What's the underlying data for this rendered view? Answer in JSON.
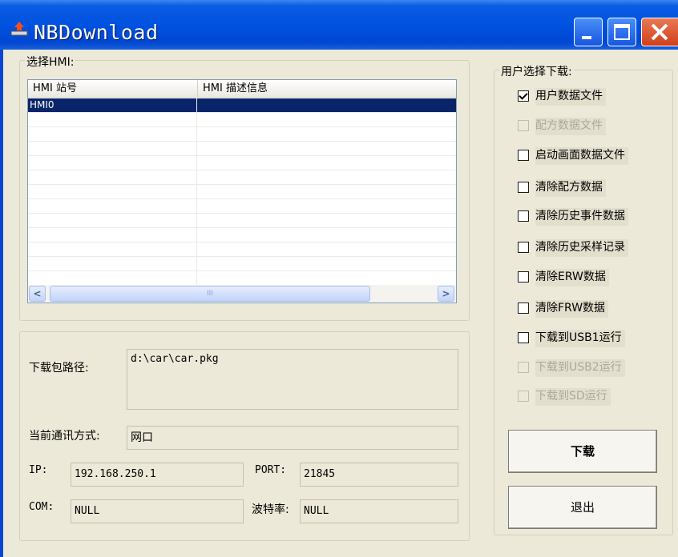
{
  "window": {
    "title": "NBDownload"
  },
  "hmi_group": {
    "title": "选择HMI:",
    "columns": [
      "HMI 站号",
      "HMI 描述信息"
    ],
    "rows": [
      {
        "station": "HMI0",
        "description": ""
      }
    ],
    "scroll_left": "<",
    "scroll_right": ">",
    "scroll_grip": "III"
  },
  "info": {
    "path_label": "下载包路径:",
    "path_value": "d:\\car\\car.pkg",
    "comm_label": "当前通讯方式:",
    "comm_value": "网口",
    "ip_label": "IP:",
    "ip_value": "192.168.250.1",
    "port_label": "PORT:",
    "port_value": "21845",
    "com_label": "COM:",
    "com_value": "NULL",
    "baud_label": "波特率:",
    "baud_value": "NULL"
  },
  "options": {
    "title": "用户选择下载:",
    "items": [
      {
        "label": "用户数据文件",
        "checked": true,
        "enabled": true
      },
      {
        "label": "配方数据文件",
        "checked": false,
        "enabled": false
      },
      {
        "label": "启动画面数据文件",
        "checked": false,
        "enabled": true
      },
      {
        "label": "清除配方数据",
        "checked": false,
        "enabled": true
      },
      {
        "label": "清除历史事件数据",
        "checked": false,
        "enabled": true
      },
      {
        "label": "清除历史采样记录",
        "checked": false,
        "enabled": true
      },
      {
        "label": "清除ERW数据",
        "checked": false,
        "enabled": true
      },
      {
        "label": "清除FRW数据",
        "checked": false,
        "enabled": true
      },
      {
        "label": "下载到USB1运行",
        "checked": false,
        "enabled": true
      },
      {
        "label": "下载到USB2运行",
        "checked": false,
        "enabled": false
      },
      {
        "label": "下载到SD运行",
        "checked": false,
        "enabled": false
      }
    ]
  },
  "buttons": {
    "download": "下载",
    "exit": "退出"
  }
}
